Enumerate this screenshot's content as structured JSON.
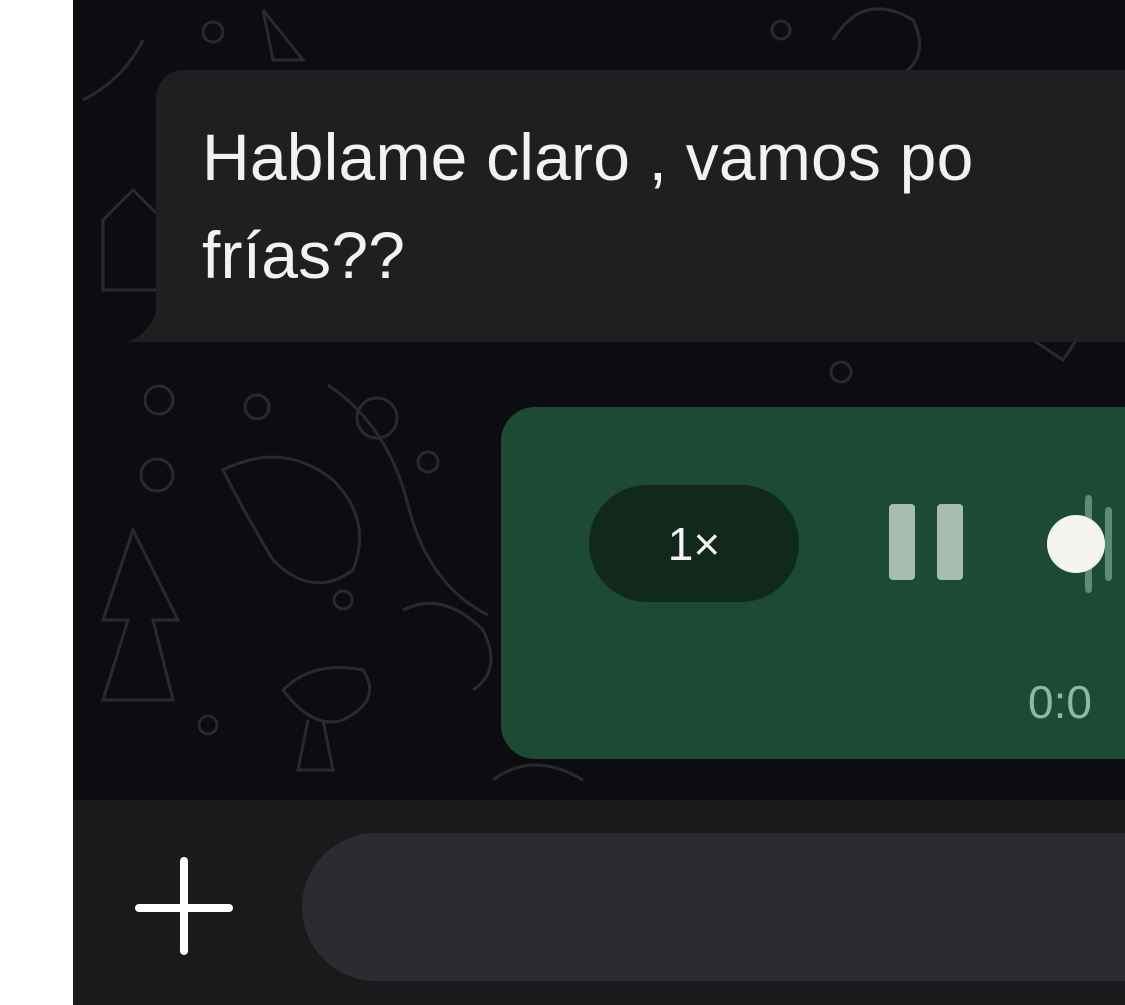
{
  "incoming_message": {
    "text": "Hablame claro , vamos po\nfrías??"
  },
  "voice_message": {
    "speed_label": "1×",
    "state_icon": "pause-icon",
    "playback_progress": 0.0,
    "duration_text": "0:0"
  },
  "composer": {
    "add_icon": "plus-icon",
    "input_value": "",
    "input_placeholder": ""
  },
  "colors": {
    "chat_background": "#0d0c10",
    "incoming_bubble": "#1f1f22",
    "outgoing_bubble": "#1c4a34",
    "speed_pill": "#11281d",
    "waveform": "#5f8a74",
    "duration_text": "#8fb7a2",
    "composer_bar": "#1a1a1c",
    "input_field": "#2c2c30"
  }
}
